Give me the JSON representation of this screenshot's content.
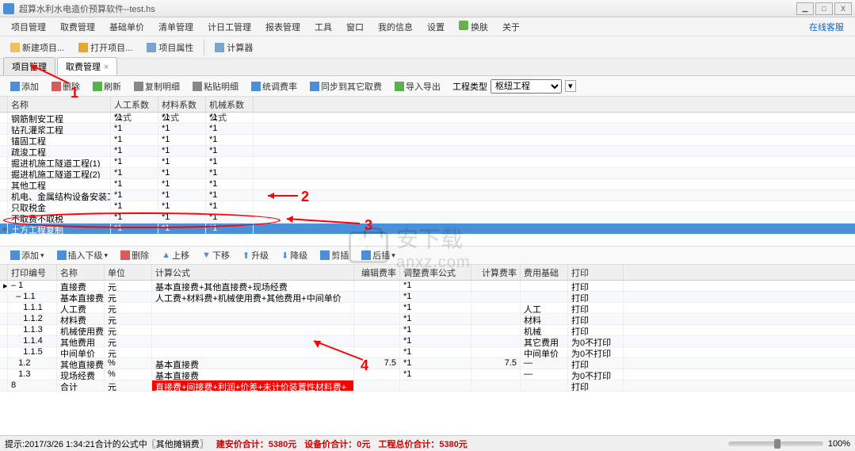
{
  "window": {
    "title": "超算水利水电造价预算软件--test.hs"
  },
  "win": {
    "min": "▁",
    "max": "□",
    "close": "X"
  },
  "menu": {
    "items": [
      "项目管理",
      "取费管理",
      "基础单价",
      "清单管理",
      "计日工管理",
      "报表管理",
      "工具",
      "窗口",
      "我的信息",
      "设置",
      "换肤",
      "关于"
    ],
    "online_cs": "在线客服"
  },
  "toolbar1": {
    "new_project": "新建项目...",
    "open_project": "打开项目...",
    "project_props": "项目属性",
    "calculator": "计算器"
  },
  "tabs": {
    "t1": "项目管理",
    "t2": "取费管理",
    "close": "×"
  },
  "toolbar2": {
    "add": "添加",
    "delete": "删除",
    "refresh": "刷新",
    "copy_detail": "复制明细",
    "paste_detail": "粘贴明细",
    "adjust_rate": "统调费率",
    "sync_others": "同步到其它取费",
    "import_export": "导入导出",
    "project_type_label": "工程类型",
    "project_type_value": "枢纽工程"
  },
  "upper_grid": {
    "headers": {
      "name": "名称",
      "f1": "人工系数公式",
      "f2": "材料系数公式",
      "f3": "机械系数公式"
    },
    "rows": [
      {
        "name": "钢筋制安工程",
        "f1": "*1",
        "f2": "*1",
        "f3": "*1"
      },
      {
        "name": "钻孔灌浆工程",
        "f1": "*1",
        "f2": "*1",
        "f3": "*1"
      },
      {
        "name": "锚固工程",
        "f1": "*1",
        "f2": "*1",
        "f3": "*1"
      },
      {
        "name": "疏浚工程",
        "f1": "*1",
        "f2": "*1",
        "f3": "*1"
      },
      {
        "name": "掘进机施工隧道工程(1)",
        "f1": "*1",
        "f2": "*1",
        "f3": "*1"
      },
      {
        "name": "掘进机施工隧道工程(2)",
        "f1": "*1",
        "f2": "*1",
        "f3": "*1"
      },
      {
        "name": "其他工程",
        "f1": "*1",
        "f2": "*1",
        "f3": "*1"
      },
      {
        "name": "机电、金属结构设备安装工程",
        "f1": "*1",
        "f2": "*1",
        "f3": "*1"
      },
      {
        "name": "只取税金",
        "f1": "*1",
        "f2": "*1",
        "f3": "*1"
      },
      {
        "name": "不取费不取税",
        "f1": "*1",
        "f2": "*1",
        "f3": "*1"
      },
      {
        "name": "土方工程复制",
        "f1": "*1",
        "f2": "*1",
        "f3": "*1",
        "selected": true
      }
    ]
  },
  "toolbar3": {
    "add": "添加",
    "insert_below": "插入下级",
    "delete": "删除",
    "move_up": "上移",
    "move_down": "下移",
    "promote": "升级",
    "demote": "降级",
    "cut": "剪插",
    "paste": "后插"
  },
  "lower_grid": {
    "headers": {
      "printno": "打印编号",
      "name": "名称",
      "unit": "单位",
      "formula": "计算公式",
      "editrate": "编辑费率",
      "adjformula": "调整费率公式",
      "calcrate": "计算费率",
      "base": "费用基础",
      "print": "打印"
    },
    "rows": [
      {
        "printno": "1",
        "name": "直接费",
        "unit": "元",
        "formula": "基本直接费+其他直接费+现场经费",
        "editrate": "",
        "adjformula": "*1",
        "calcrate": "",
        "base": "",
        "print": "打印"
      },
      {
        "printno": "1.1",
        "name": "基本直接费",
        "unit": "元",
        "formula": "人工费+材料费+机械使用费+其他费用+中间单价",
        "editrate": "",
        "adjformula": "*1",
        "calcrate": "",
        "base": "",
        "print": "打印"
      },
      {
        "printno": "1.1.1",
        "name": "人工费",
        "unit": "元",
        "formula": "",
        "editrate": "",
        "adjformula": "*1",
        "calcrate": "",
        "base": "人工",
        "print": "打印"
      },
      {
        "printno": "1.1.2",
        "name": "材料费",
        "unit": "元",
        "formula": "",
        "editrate": "",
        "adjformula": "*1",
        "calcrate": "",
        "base": "材料",
        "print": "打印"
      },
      {
        "printno": "1.1.3",
        "name": "机械使用费",
        "unit": "元",
        "formula": "",
        "editrate": "",
        "adjformula": "*1",
        "calcrate": "",
        "base": "机械",
        "print": "打印"
      },
      {
        "printno": "1.1.4",
        "name": "其他费用",
        "unit": "元",
        "formula": "",
        "editrate": "",
        "adjformula": "*1",
        "calcrate": "",
        "base": "其它费用",
        "print": "为0不打印"
      },
      {
        "printno": "1.1.5",
        "name": "中间单价",
        "unit": "元",
        "formula": "",
        "editrate": "",
        "adjformula": "*1",
        "calcrate": "",
        "base": "中间单价",
        "print": "为0不打印"
      },
      {
        "printno": "1.2",
        "name": "其他直接费",
        "unit": "%",
        "formula": "基本直接费",
        "editrate": "7.5",
        "adjformula": "*1",
        "calcrate": "7.5",
        "base": "—",
        "print": "打印"
      },
      {
        "printno": "1.3",
        "name": "现场经费",
        "unit": "%",
        "formula": "基本直接费",
        "editrate": "",
        "adjformula": "*1",
        "calcrate": "",
        "base": "—",
        "print": "为0不打印"
      },
      {
        "printno": "8",
        "name": "合计",
        "unit": "元",
        "formula": "直接费+间接费+利润+价差+未计价装置性材料费+",
        "editrate": "",
        "adjformula": "",
        "calcrate": "",
        "base": "",
        "print": "打印",
        "highlight": true
      }
    ]
  },
  "annotations": {
    "a1": "1",
    "a2": "2",
    "a3": "3",
    "a4": "4"
  },
  "status": {
    "hint": "提示:2017/3/26 1:34:21合计的公式中〖其他摊销费〗",
    "jianAn": "建安价合计：5380元",
    "equip": "设备价合计：0元",
    "total": "工程总价合计：5380元",
    "zoom": "100%"
  },
  "watermark": {
    "text": "安下载",
    "sub": "anxz.com"
  }
}
